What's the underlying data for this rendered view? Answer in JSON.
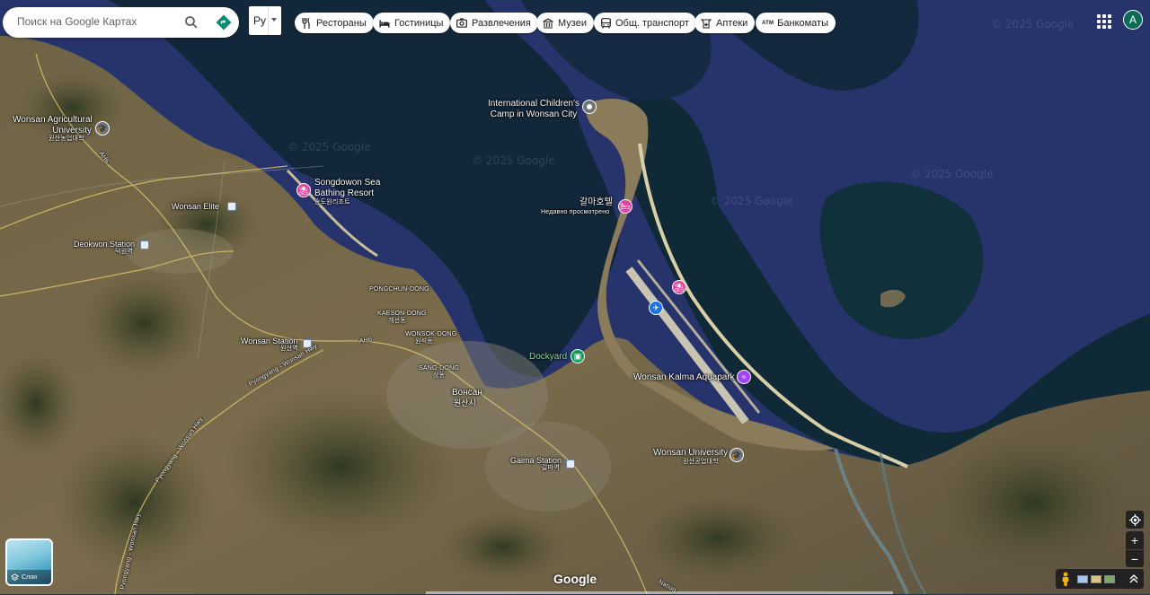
{
  "search": {
    "placeholder": "Поиск на Google Картах"
  },
  "language_button": {
    "label": "Ру"
  },
  "category_chips": [
    {
      "label": "Рестораны",
      "icon": "fork-knife-icon"
    },
    {
      "label": "Гостиницы",
      "icon": "bed-icon"
    },
    {
      "label": "Развлечения",
      "icon": "camera-icon"
    },
    {
      "label": "Музеи",
      "icon": "museum-icon"
    },
    {
      "label": "Общ. транспорт",
      "icon": "bus-icon"
    },
    {
      "label": "Аптеки",
      "icon": "pharmacy-icon"
    },
    {
      "label": "Банкоматы",
      "icon": "atm-icon",
      "icon_text": "ATM"
    }
  ],
  "account": {
    "avatar_letter": "A"
  },
  "map": {
    "watermark": "© 2025 Google",
    "places": {
      "camp": "International Children's\nCamp in Wonsan City",
      "agri_univ": "Wonsan Agricultural\nUniversity",
      "agri_univ_kr": "원산농업대학",
      "songdowon": "Songdowon Sea\nBathing Resort",
      "songdowon_kr": "송도원리조트",
      "wonsan_elite": "Wonsan Elite",
      "deokwon": "Deokwon Station",
      "deokwon_kr": "덕원역",
      "kalma_hotel": "갈마호텔",
      "kalma_hotel_sub": "Недавно просмотрено",
      "pongchun": "PONGCHUN-DONG",
      "kaeson": "KAESON-DONG",
      "kaeson_kr": "개선동",
      "wonsok": "WONSOK-DONG",
      "wonsok_kr": "원석동",
      "sang": "SANG-DONG",
      "sang_kr": "상동",
      "wonsan_station": "Wonsan Station",
      "wonsan_station_kr": "원산역",
      "ah6_a": "AH6",
      "ah6_b": "AH6",
      "city": "Вонсан",
      "city_kr": "원산시",
      "dockyard": "Dockyard",
      "aquapark": "Wonsan Kalma Aquapark",
      "galma_station": "Galma Station",
      "galma_station_kr": "갈마역",
      "wonsan_univ": "Wonsan University",
      "wonsan_univ_kr": "원산공업대학",
      "hwy_a": "Pyongyang - Wonsan Hwy",
      "hwy_b": "Pyongyang - Wonsan Hwy",
      "hwy_c": "Pyongyang - Wonsan Hwy",
      "national": "Nation"
    }
  },
  "layers": {
    "label": "Слои"
  },
  "footer": {
    "logo": "Google"
  },
  "colors": {
    "sea": "#26336a",
    "sea_dark": "#0f2a3a",
    "land": "#6b5f45",
    "marker_pink": "#e043a3",
    "marker_blue": "#1a73e8",
    "marker_green": "#0f9d58",
    "marker_purple": "#a142f4",
    "marker_gray": "#70757a",
    "dockyard_text": "#7ce29b"
  }
}
